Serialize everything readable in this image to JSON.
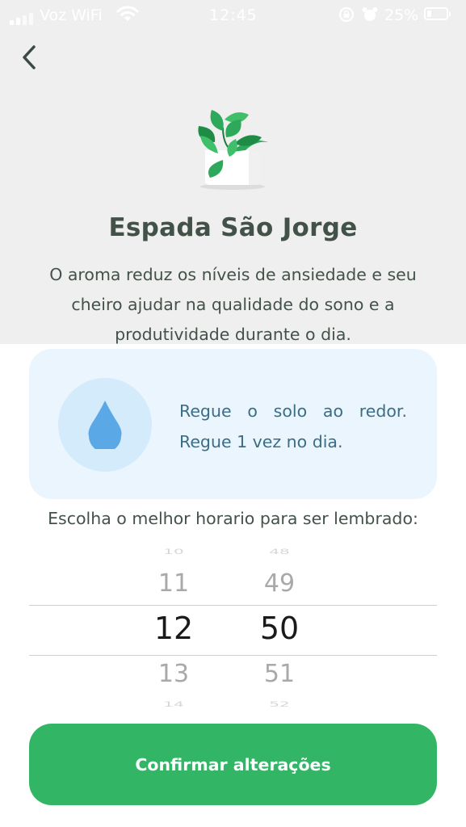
{
  "status_bar": {
    "carrier": "Voz WiFi",
    "time": "12:45",
    "battery": "25%"
  },
  "plant": {
    "name": "Espada São Jorge",
    "description": "O aroma reduz os níveis de ansiedade e seu cheiro ajudar na qualidade do sono e a produtividade durante o dia."
  },
  "water_card": {
    "line1": "Regue o solo ao redor.",
    "line2": "Regue 1 vez no dia.",
    "accent_color": "#5aa9e6"
  },
  "reminder": {
    "label": "Escolha o melhor horario para ser lembrado:",
    "hours": [
      "10",
      "11",
      "12",
      "13",
      "14"
    ],
    "minutes": [
      "48",
      "49",
      "50",
      "51",
      "52"
    ],
    "selected_hour": "12",
    "selected_minute": "50"
  },
  "confirm_button": {
    "label": "Confirmar alterações",
    "color": "#33b566"
  }
}
